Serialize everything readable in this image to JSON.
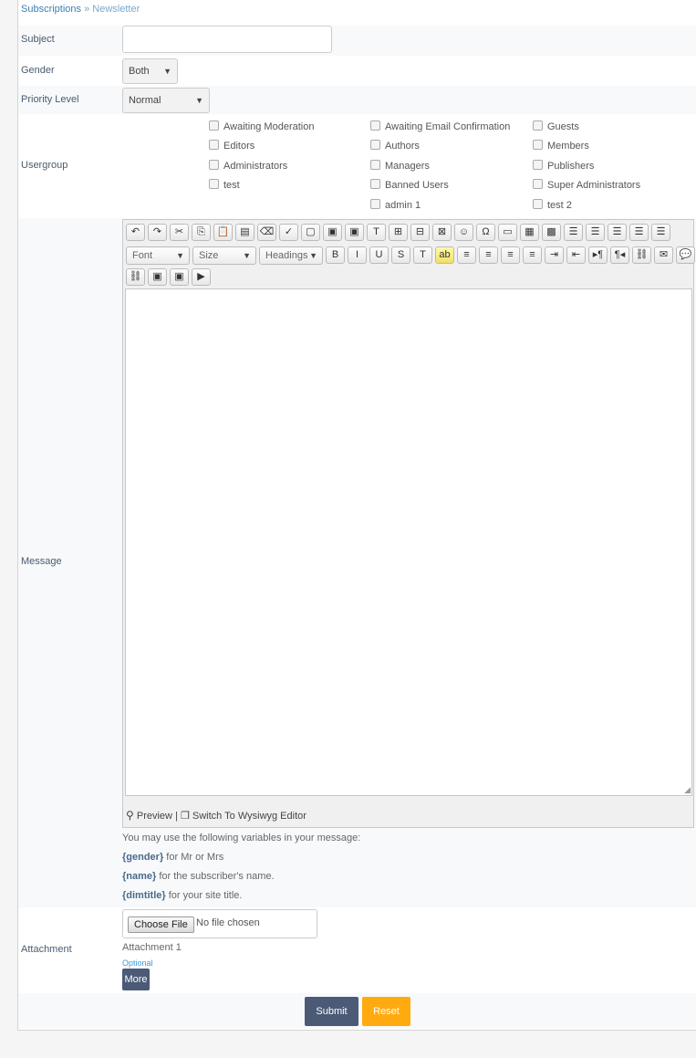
{
  "breadcrumb": {
    "parent": "Subscriptions",
    "separator": "»",
    "current": "Newsletter"
  },
  "form": {
    "subject": {
      "label": "Subject",
      "value": ""
    },
    "gender": {
      "label": "Gender",
      "selected": "Both"
    },
    "priority": {
      "label": "Priority Level",
      "selected": "Normal"
    },
    "usergroup": {
      "label": "Usergroup",
      "options": [
        "Awaiting Moderation",
        "Awaiting Email Confirmation",
        "Guests",
        "Editors",
        "Authors",
        "Members",
        "Administrators",
        "Managers",
        "Publishers",
        "test",
        "Banned Users",
        "Super Administrators",
        "admin 1",
        "test 2"
      ]
    },
    "message": {
      "label": "Message",
      "font_placeholder": "Font",
      "size_placeholder": "Size",
      "headings_placeholder": "Headings",
      "body": "",
      "preview_label": "Preview",
      "divider": "|",
      "wysiwyg_label": "Switch To Wysiwyg Editor"
    },
    "variables": {
      "intro": "You may use the following variables in your message:",
      "items": [
        {
          "tag": "{gender}",
          "desc": " for Mr or Mrs"
        },
        {
          "tag": "{name}",
          "desc": " for the subscriber's name."
        },
        {
          "tag": "{dimtitle}",
          "desc": " for your site title."
        }
      ]
    },
    "attachment": {
      "label": "Attachment",
      "choose_label": "Choose File",
      "no_file": "No file chosen",
      "item_label": "Attachment 1",
      "optional": "Optional",
      "more_label": "More"
    }
  },
  "actions": {
    "submit": "Submit",
    "reset": "Reset"
  },
  "colors": {
    "link": "#3a7fb0",
    "submit": "#4b5a77",
    "reset": "#ffab10",
    "more": "#4b5a77"
  }
}
